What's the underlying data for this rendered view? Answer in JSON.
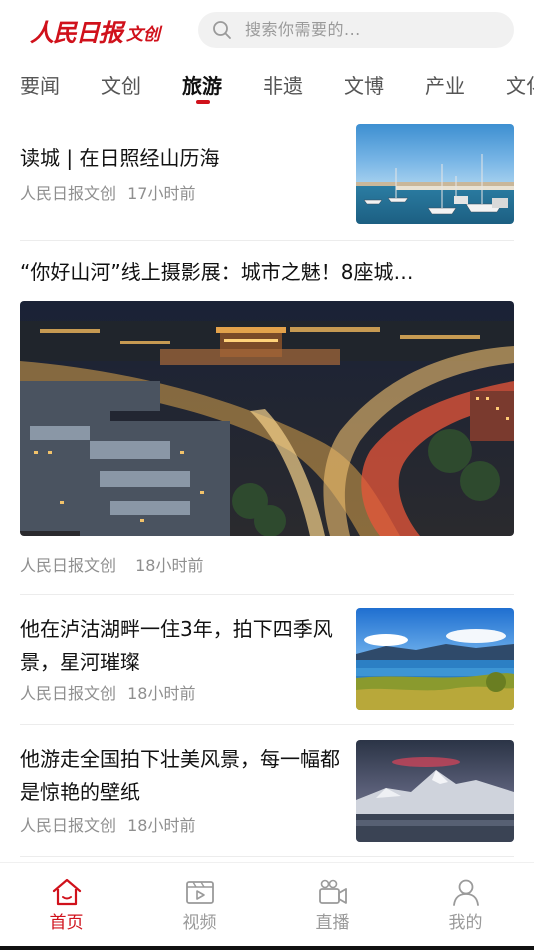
{
  "header": {
    "logo_main": "人民日报",
    "logo_sub": "文创",
    "search_placeholder": "搜索你需要的..."
  },
  "tabs": [
    {
      "label": "要闻",
      "active": false
    },
    {
      "label": "文创",
      "active": false
    },
    {
      "label": "旅游",
      "active": true
    },
    {
      "label": "非遗",
      "active": false
    },
    {
      "label": "文博",
      "active": false
    },
    {
      "label": "产业",
      "active": false
    },
    {
      "label": "文化",
      "active": false
    }
  ],
  "feed": [
    {
      "title": "读城 | 在日照经山历海",
      "source": "人民日报文创",
      "time": "17小时前",
      "image": "harbor-marina-photo"
    },
    {
      "title": "“你好山河”线上摄影展：城市之魅！8座城…",
      "source": "人民日报文创",
      "time": "18小时前",
      "image": "city-night-highway-photo"
    },
    {
      "title": "他在泸沽湖畔一住3年，拍下四季风景，星河璀璨",
      "source": "人民日报文创",
      "time": "18小时前",
      "image": "lugu-lake-photo"
    },
    {
      "title": "他游走全国拍下壮美风景，每一幅都是惊艳的壁纸",
      "source": "人民日报文创",
      "time": "18小时前",
      "image": "snow-mountain-sunset-photo"
    }
  ],
  "bottom_nav": [
    {
      "label": "首页",
      "icon": "home-icon",
      "active": true
    },
    {
      "label": "视频",
      "icon": "video-icon",
      "active": false
    },
    {
      "label": "直播",
      "icon": "live-camera-icon",
      "active": false
    },
    {
      "label": "我的",
      "icon": "profile-icon",
      "active": false
    }
  ],
  "colors": {
    "brand_red": "#d0111b",
    "inactive_gray": "#9a9a9a"
  }
}
